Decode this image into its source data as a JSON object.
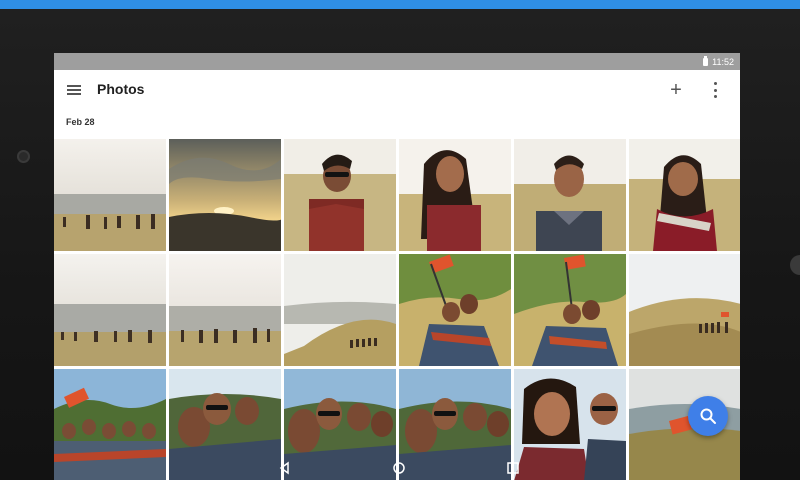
{
  "status_bar": {
    "time": "11:52",
    "battery_icon": "battery-icon"
  },
  "app_bar": {
    "title": "Photos",
    "menu_icon": "menu-icon",
    "add_icon": "add-icon",
    "more_icon": "more-vert-icon"
  },
  "section": {
    "date": "Feb 28"
  },
  "photos": [
    {
      "scene": "landscape-group-hillside"
    },
    {
      "scene": "sunset-valley-clouds"
    },
    {
      "scene": "portrait-man-sunglasses"
    },
    {
      "scene": "portrait-woman-smiling"
    },
    {
      "scene": "portrait-man-field"
    },
    {
      "scene": "portrait-woman-scarf"
    },
    {
      "scene": "landscape-group-haze"
    },
    {
      "scene": "landscape-group-bright"
    },
    {
      "scene": "landscape-hill-distant"
    },
    {
      "scene": "group-with-flag"
    },
    {
      "scene": "group-with-flag-closeup"
    },
    {
      "scene": "hill-group-small"
    },
    {
      "scene": "group-flag-trees"
    },
    {
      "scene": "group-selfie-1"
    },
    {
      "scene": "group-selfie-2"
    },
    {
      "scene": "group-selfie-3"
    },
    {
      "scene": "portrait-couple-closeup"
    },
    {
      "scene": "hill-flag-overcast"
    }
  ],
  "fab": {
    "icon": "search-icon",
    "color": "#3f7fe8"
  },
  "colors": {
    "accent": "#2f8fe6",
    "status_bar": "#9e9e9e"
  }
}
